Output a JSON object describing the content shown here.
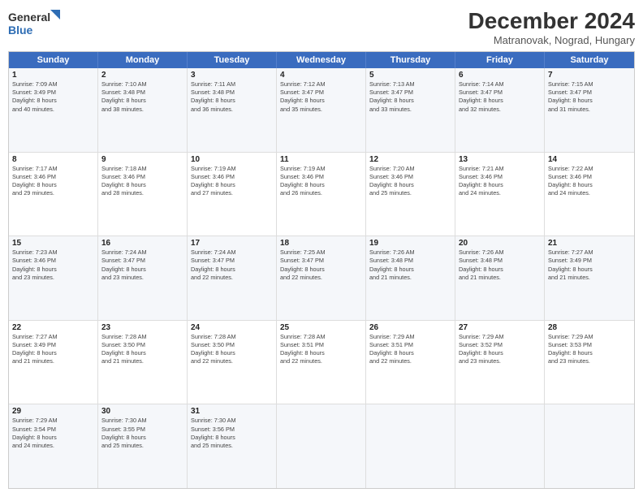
{
  "header": {
    "logo_line1": "General",
    "logo_line2": "Blue",
    "month": "December 2024",
    "location": "Matranovak, Nograd, Hungary"
  },
  "days_of_week": [
    "Sunday",
    "Monday",
    "Tuesday",
    "Wednesday",
    "Thursday",
    "Friday",
    "Saturday"
  ],
  "weeks": [
    [
      {
        "day": "1",
        "lines": [
          "Sunrise: 7:09 AM",
          "Sunset: 3:49 PM",
          "Daylight: 8 hours",
          "and 40 minutes."
        ]
      },
      {
        "day": "2",
        "lines": [
          "Sunrise: 7:10 AM",
          "Sunset: 3:48 PM",
          "Daylight: 8 hours",
          "and 38 minutes."
        ]
      },
      {
        "day": "3",
        "lines": [
          "Sunrise: 7:11 AM",
          "Sunset: 3:48 PM",
          "Daylight: 8 hours",
          "and 36 minutes."
        ]
      },
      {
        "day": "4",
        "lines": [
          "Sunrise: 7:12 AM",
          "Sunset: 3:47 PM",
          "Daylight: 8 hours",
          "and 35 minutes."
        ]
      },
      {
        "day": "5",
        "lines": [
          "Sunrise: 7:13 AM",
          "Sunset: 3:47 PM",
          "Daylight: 8 hours",
          "and 33 minutes."
        ]
      },
      {
        "day": "6",
        "lines": [
          "Sunrise: 7:14 AM",
          "Sunset: 3:47 PM",
          "Daylight: 8 hours",
          "and 32 minutes."
        ]
      },
      {
        "day": "7",
        "lines": [
          "Sunrise: 7:15 AM",
          "Sunset: 3:47 PM",
          "Daylight: 8 hours",
          "and 31 minutes."
        ]
      }
    ],
    [
      {
        "day": "8",
        "lines": [
          "Sunrise: 7:17 AM",
          "Sunset: 3:46 PM",
          "Daylight: 8 hours",
          "and 29 minutes."
        ]
      },
      {
        "day": "9",
        "lines": [
          "Sunrise: 7:18 AM",
          "Sunset: 3:46 PM",
          "Daylight: 8 hours",
          "and 28 minutes."
        ]
      },
      {
        "day": "10",
        "lines": [
          "Sunrise: 7:19 AM",
          "Sunset: 3:46 PM",
          "Daylight: 8 hours",
          "and 27 minutes."
        ]
      },
      {
        "day": "11",
        "lines": [
          "Sunrise: 7:19 AM",
          "Sunset: 3:46 PM",
          "Daylight: 8 hours",
          "and 26 minutes."
        ]
      },
      {
        "day": "12",
        "lines": [
          "Sunrise: 7:20 AM",
          "Sunset: 3:46 PM",
          "Daylight: 8 hours",
          "and 25 minutes."
        ]
      },
      {
        "day": "13",
        "lines": [
          "Sunrise: 7:21 AM",
          "Sunset: 3:46 PM",
          "Daylight: 8 hours",
          "and 24 minutes."
        ]
      },
      {
        "day": "14",
        "lines": [
          "Sunrise: 7:22 AM",
          "Sunset: 3:46 PM",
          "Daylight: 8 hours",
          "and 24 minutes."
        ]
      }
    ],
    [
      {
        "day": "15",
        "lines": [
          "Sunrise: 7:23 AM",
          "Sunset: 3:46 PM",
          "Daylight: 8 hours",
          "and 23 minutes."
        ]
      },
      {
        "day": "16",
        "lines": [
          "Sunrise: 7:24 AM",
          "Sunset: 3:47 PM",
          "Daylight: 8 hours",
          "and 23 minutes."
        ]
      },
      {
        "day": "17",
        "lines": [
          "Sunrise: 7:24 AM",
          "Sunset: 3:47 PM",
          "Daylight: 8 hours",
          "and 22 minutes."
        ]
      },
      {
        "day": "18",
        "lines": [
          "Sunrise: 7:25 AM",
          "Sunset: 3:47 PM",
          "Daylight: 8 hours",
          "and 22 minutes."
        ]
      },
      {
        "day": "19",
        "lines": [
          "Sunrise: 7:26 AM",
          "Sunset: 3:48 PM",
          "Daylight: 8 hours",
          "and 21 minutes."
        ]
      },
      {
        "day": "20",
        "lines": [
          "Sunrise: 7:26 AM",
          "Sunset: 3:48 PM",
          "Daylight: 8 hours",
          "and 21 minutes."
        ]
      },
      {
        "day": "21",
        "lines": [
          "Sunrise: 7:27 AM",
          "Sunset: 3:49 PM",
          "Daylight: 8 hours",
          "and 21 minutes."
        ]
      }
    ],
    [
      {
        "day": "22",
        "lines": [
          "Sunrise: 7:27 AM",
          "Sunset: 3:49 PM",
          "Daylight: 8 hours",
          "and 21 minutes."
        ]
      },
      {
        "day": "23",
        "lines": [
          "Sunrise: 7:28 AM",
          "Sunset: 3:50 PM",
          "Daylight: 8 hours",
          "and 21 minutes."
        ]
      },
      {
        "day": "24",
        "lines": [
          "Sunrise: 7:28 AM",
          "Sunset: 3:50 PM",
          "Daylight: 8 hours",
          "and 22 minutes."
        ]
      },
      {
        "day": "25",
        "lines": [
          "Sunrise: 7:28 AM",
          "Sunset: 3:51 PM",
          "Daylight: 8 hours",
          "and 22 minutes."
        ]
      },
      {
        "day": "26",
        "lines": [
          "Sunrise: 7:29 AM",
          "Sunset: 3:51 PM",
          "Daylight: 8 hours",
          "and 22 minutes."
        ]
      },
      {
        "day": "27",
        "lines": [
          "Sunrise: 7:29 AM",
          "Sunset: 3:52 PM",
          "Daylight: 8 hours",
          "and 23 minutes."
        ]
      },
      {
        "day": "28",
        "lines": [
          "Sunrise: 7:29 AM",
          "Sunset: 3:53 PM",
          "Daylight: 8 hours",
          "and 23 minutes."
        ]
      }
    ],
    [
      {
        "day": "29",
        "lines": [
          "Sunrise: 7:29 AM",
          "Sunset: 3:54 PM",
          "Daylight: 8 hours",
          "and 24 minutes."
        ]
      },
      {
        "day": "30",
        "lines": [
          "Sunrise: 7:30 AM",
          "Sunset: 3:55 PM",
          "Daylight: 8 hours",
          "and 25 minutes."
        ]
      },
      {
        "day": "31",
        "lines": [
          "Sunrise: 7:30 AM",
          "Sunset: 3:56 PM",
          "Daylight: 8 hours",
          "and 25 minutes."
        ]
      },
      {
        "day": "",
        "lines": []
      },
      {
        "day": "",
        "lines": []
      },
      {
        "day": "",
        "lines": []
      },
      {
        "day": "",
        "lines": []
      }
    ]
  ]
}
